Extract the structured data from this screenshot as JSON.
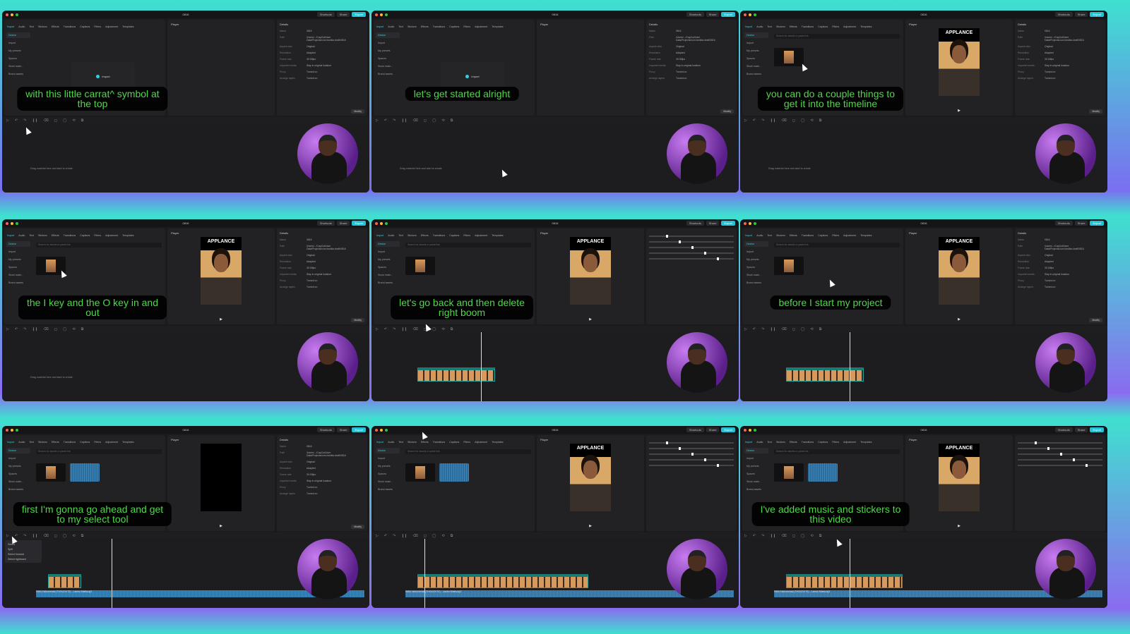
{
  "app": {
    "title": "0816",
    "shortcuts": "Shortcuts",
    "share": "Share",
    "export": "Export",
    "player_label": "Player",
    "details_label": "Details",
    "modify": "Modify",
    "import_label": "Import",
    "search_placeholder": "Search for assets or paste link",
    "drop_text": "Drag material here and start to create",
    "colors": {
      "accent": "#2ed3df",
      "caption": "#4fd84a"
    }
  },
  "tabs": [
    "Import",
    "Audio",
    "Text",
    "Stickers",
    "Effects",
    "Transitions",
    "Captions",
    "Filters",
    "Adjustment",
    "Templates"
  ],
  "nav": [
    "Device",
    "Import",
    "My presets",
    "Spaces",
    "Stock mate...",
    "Brand assets"
  ],
  "details": [
    [
      "Name",
      "0816"
    ],
    [
      "Path",
      "/Users/.../CapCut/User Data/Projects/com.lveditor.draft/0816"
    ],
    [
      "Aspect ratio",
      "Original"
    ],
    [
      "Resolution",
      "Adapted"
    ],
    [
      "Frame rate",
      "30.00fps"
    ],
    [
      "Imported media",
      "Stay in original location"
    ],
    [
      "Proxy",
      "Turned on"
    ],
    [
      "Arrange layers",
      "Turned on"
    ]
  ],
  "select_menu": [
    "Select",
    "Split",
    "Select forward",
    "Select rightward"
  ],
  "audio_label": "Hello Instrumental (THOUGHTS) - Lambo Mathuraj3",
  "panels": [
    {
      "caption": "with this little carrat^ symbol at\nthe top",
      "media": "empty",
      "player": "empty",
      "right": "details",
      "video": 0,
      "audio": false
    },
    {
      "caption": "let's get started alright",
      "media": "empty",
      "player": "empty",
      "right": "details",
      "video": 0,
      "audio": false
    },
    {
      "caption": "you can do a couple things to\nget it into the timeline",
      "media": "one",
      "player": "video",
      "right": "details",
      "video": 0,
      "audio": false
    },
    {
      "caption": "the I key and the O key in and\nout",
      "media": "one",
      "player": "video",
      "right": "details",
      "video": 0,
      "audio": false
    },
    {
      "caption": "let's go back and then delete\nright boom",
      "media": "one",
      "player": "video",
      "right": "transform",
      "video": 200,
      "audio": false
    },
    {
      "caption": "before I start my project",
      "media": "one",
      "player": "video",
      "right": "details",
      "video": 200,
      "audio": false
    },
    {
      "caption": "first I'm gonna go ahead and get\nto my select tool",
      "media": "two",
      "player": "black",
      "right": "details",
      "video": 85,
      "audio": true,
      "menu": true
    },
    {
      "caption": "",
      "media": "two",
      "player": "video",
      "right": "audio",
      "video": 440,
      "audio": true
    },
    {
      "caption": "I've added music and stickers to\nthis video",
      "media": "two",
      "player": "video",
      "right": "transform",
      "video": 300,
      "audio": true
    }
  ]
}
